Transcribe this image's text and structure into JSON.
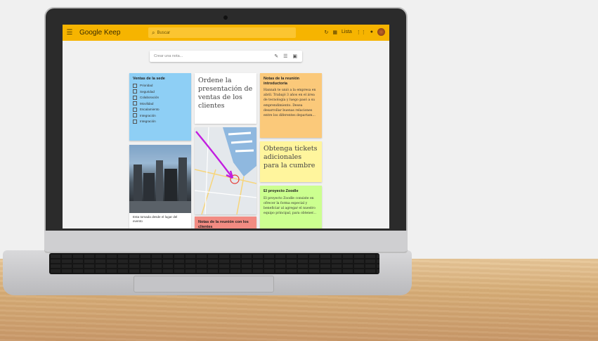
{
  "app": {
    "brand": "Google Keep",
    "search_placeholder": "Buscar",
    "view_label": "Lista",
    "take_note_placeholder": "Crear una nota..."
  },
  "notes": {
    "sales_week": {
      "title": "Ventas de la sede",
      "items": [
        "Prioridad",
        "Seguridad",
        "Colaboración",
        "Movilidad",
        "Escalamiento",
        "Integración",
        "Integración"
      ],
      "color": "#8ecff5"
    },
    "order_presentation": {
      "text": "Ordene la presentación de ventas de los clientes",
      "color": "#ffffff"
    },
    "meeting_notes": {
      "title": "Notas de la reunión introductoria",
      "body": "Hannah te unió a la empresa en abril. Trabajó 3 años en el área de tecnología y luego pasó a su emprendimiento. Desea desarrollar buenas relaciones entre los diferentes departam...",
      "color": "#fbc97a"
    },
    "tickets": {
      "text": "Obtenga tickets adicionales para la cumbre",
      "color": "#fff59d"
    },
    "project": {
      "title": "El proyecto Zoodle",
      "body": "El proyecto Zoodle consiste en ofrecer la forma especial y beneficiar al agregar el nuestro equipo principal, para obtener...",
      "color": "#ccff90"
    },
    "photo_note": {
      "caption": "Esta tomada desde el lugar del evento"
    },
    "meeting_red": {
      "title": "Notas de la reunión con los clientes",
      "color": "#f28b82"
    }
  },
  "colors": {
    "keep_yellow": "#f6b400",
    "arrow_magenta": "#c21ee0"
  }
}
